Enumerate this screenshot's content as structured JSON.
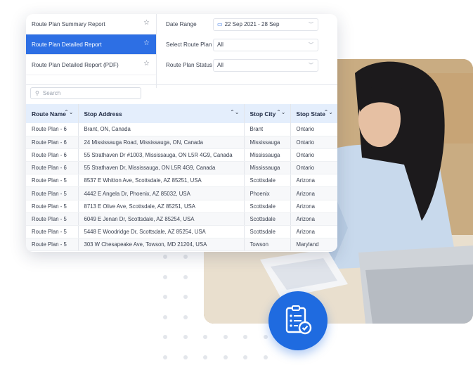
{
  "reports": [
    {
      "label": "Route Plan Summary Report",
      "active": false
    },
    {
      "label": "Route Plan Detailed Report",
      "active": true
    },
    {
      "label": "Route Plan Detailed Report (PDF)",
      "active": false
    }
  ],
  "filters": {
    "date_range": {
      "label": "Date Range",
      "value": "22 Sep 2021 - 28 Sep"
    },
    "route_plan": {
      "label": "Select Route Plan",
      "value": "All"
    },
    "route_plan_status": {
      "label": "Route Plan Status",
      "value": "All"
    }
  },
  "search": {
    "placeholder": "Search"
  },
  "table": {
    "columns": [
      "Route Name",
      "Stop Address",
      "Stop City",
      "Stop State"
    ],
    "rows": [
      [
        "Route Plan - 6",
        "Brant, ON, Canada",
        "Brant",
        "Ontario"
      ],
      [
        "Route Plan - 6",
        "24 Mississauga Road, Mississauga, ON, Canada",
        "Mississauga",
        "Ontario"
      ],
      [
        "Route Plan - 6",
        "55 Strathaven Dr #1003, Mississauga, ON L5R 4G9, Canada",
        "Mississauga",
        "Ontario"
      ],
      [
        "Route Plan - 6",
        "55 Strathaven Dr, Mississauga, ON L5R 4G9, Canada",
        "Mississauga",
        "Ontario"
      ],
      [
        "Route Plan - 5",
        "8537 E Whitton Ave, Scottsdale, AZ 85251, USA",
        "Scottsdale",
        "Arizona"
      ],
      [
        "Route Plan - 5",
        "4442 E Angela Dr, Phoenix, AZ 85032, USA",
        "Phoenix",
        "Arizona"
      ],
      [
        "Route Plan - 5",
        "8713 E Olive Ave, Scottsdale, AZ 85251, USA",
        "Scottsdale",
        "Arizona"
      ],
      [
        "Route Plan - 5",
        "6049 E Jenan Dr, Scottsdale, AZ 85254, USA",
        "Scottsdale",
        "Arizona"
      ],
      [
        "Route Plan - 5",
        "5448 E Woodridge Dr, Scottsdale, AZ 85254, USA",
        "Scottsdale",
        "Arizona"
      ],
      [
        "Route Plan - 5",
        "303 W Chesapeake Ave, Towson, MD 21204, USA",
        "Towson",
        "Maryland"
      ]
    ]
  },
  "colors": {
    "accent": "#2d6fe4",
    "header_bg": "#e4eefc",
    "badge": "#1f6be0"
  },
  "icons": {
    "star": "star-icon",
    "calendar": "calendar-icon",
    "search": "search-icon",
    "badge": "checklist-icon"
  }
}
